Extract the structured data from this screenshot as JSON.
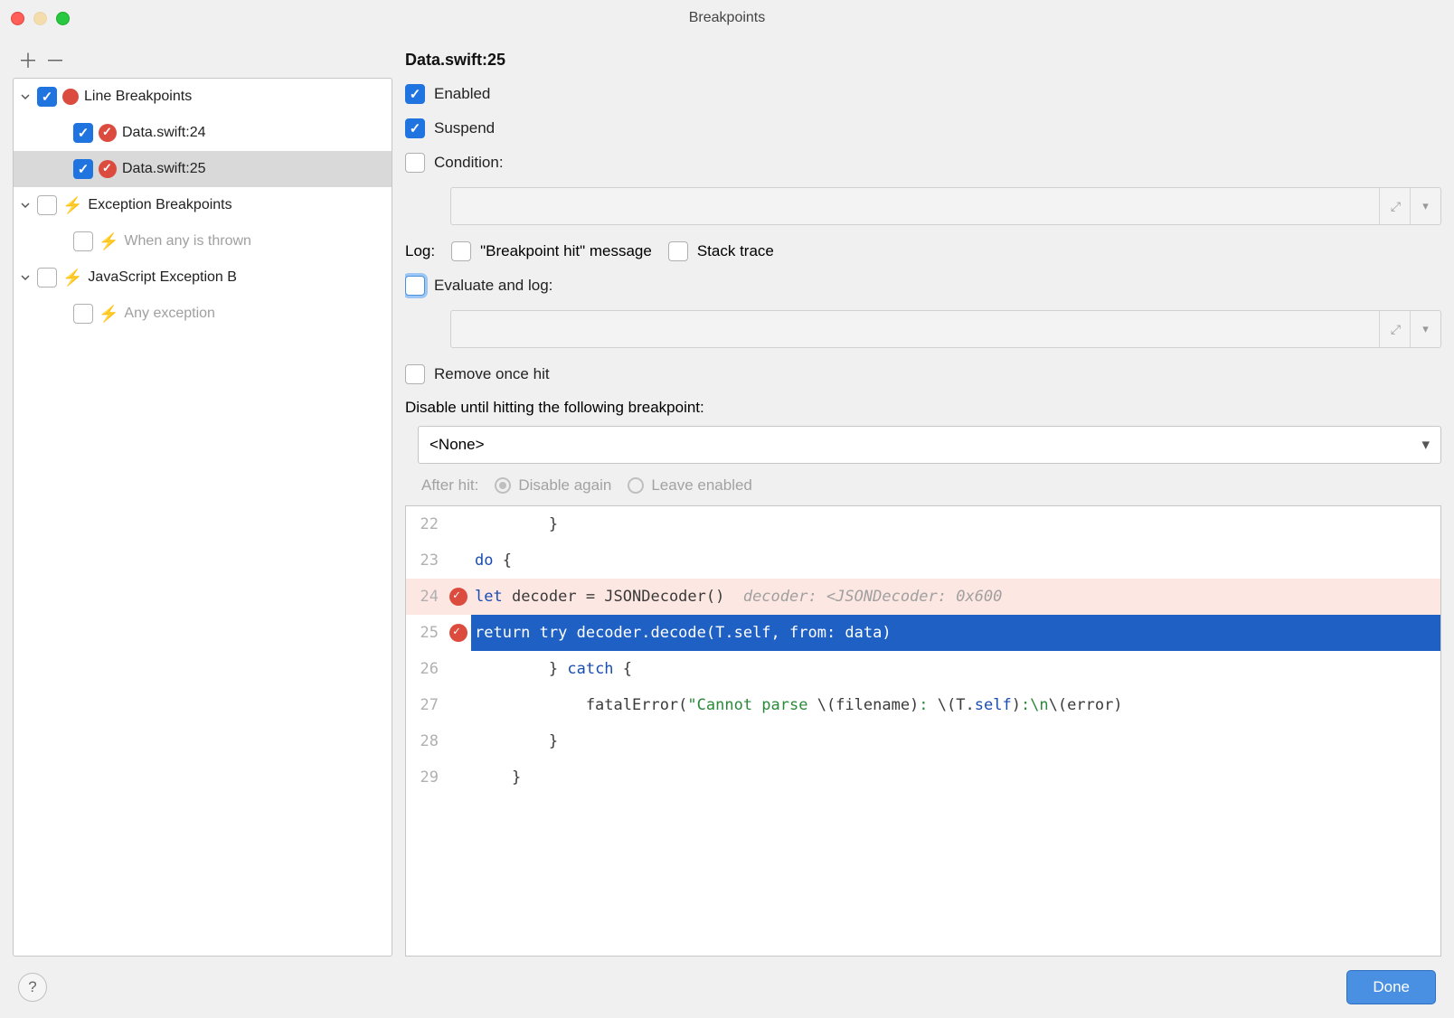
{
  "title": "Breakpoints",
  "sidebar": {
    "groups": [
      {
        "label": "Line Breakpoints",
        "checked": true,
        "children": [
          {
            "label": "Data.swift:24",
            "checked": true,
            "selected": false
          },
          {
            "label": "Data.swift:25",
            "checked": true,
            "selected": true
          }
        ]
      },
      {
        "label": "Exception Breakpoints",
        "checked": false,
        "children": [
          {
            "label": "When any is thrown",
            "checked": false,
            "selected": false,
            "grey": true
          }
        ]
      },
      {
        "label": "JavaScript Exception B",
        "checked": false,
        "children": [
          {
            "label": "Any exception",
            "checked": false,
            "selected": false,
            "grey": true
          }
        ]
      }
    ]
  },
  "details": {
    "heading": "Data.swift:25",
    "enabled_label": "Enabled",
    "enabled": true,
    "suspend_label": "Suspend",
    "suspend": true,
    "condition_label": "Condition:",
    "condition_checked": false,
    "log_label": "Log:",
    "log_message_label": "\"Breakpoint hit\" message",
    "log_message": false,
    "stack_trace_label": "Stack trace",
    "stack_trace": false,
    "eval_log_label": "Evaluate and log:",
    "eval_log": false,
    "remove_once_label": "Remove once hit",
    "remove_once": false,
    "disable_until_label": "Disable until hitting the following breakpoint:",
    "disable_until_value": "<None>",
    "after_hit_label": "After hit:",
    "after_hit_options": [
      "Disable again",
      "Leave enabled"
    ],
    "after_hit_selected": 0
  },
  "code": {
    "lines": [
      {
        "n": 22,
        "html": "        }"
      },
      {
        "n": 23,
        "html": "        <span class='kw'>do</span> {"
      },
      {
        "n": 24,
        "bp": true,
        "hit": true,
        "html": "            <span class='kw'>let</span> decoder = JSONDecoder()  <span class='cmt'>decoder: &lt;JSONDecoder: 0x600</span>"
      },
      {
        "n": 25,
        "bp": true,
        "current": true,
        "html": "            <span class='kw-inv'>return try</span> decoder.decode(T.<span class='kw-inv'>self</span>, from: data)"
      },
      {
        "n": 26,
        "html": "        } <span class='kw'>catch</span> {"
      },
      {
        "n": 27,
        "html": "            fatalError(<span class='str'>\"Cannot parse </span>\\(filename)<span class='str'>: </span>\\(T.<span class='kw'>self</span>)<span class='str'>:\\n</span>\\(error)"
      },
      {
        "n": 28,
        "html": "        }"
      },
      {
        "n": 29,
        "html": "    }"
      }
    ]
  },
  "footer": {
    "done": "Done"
  }
}
